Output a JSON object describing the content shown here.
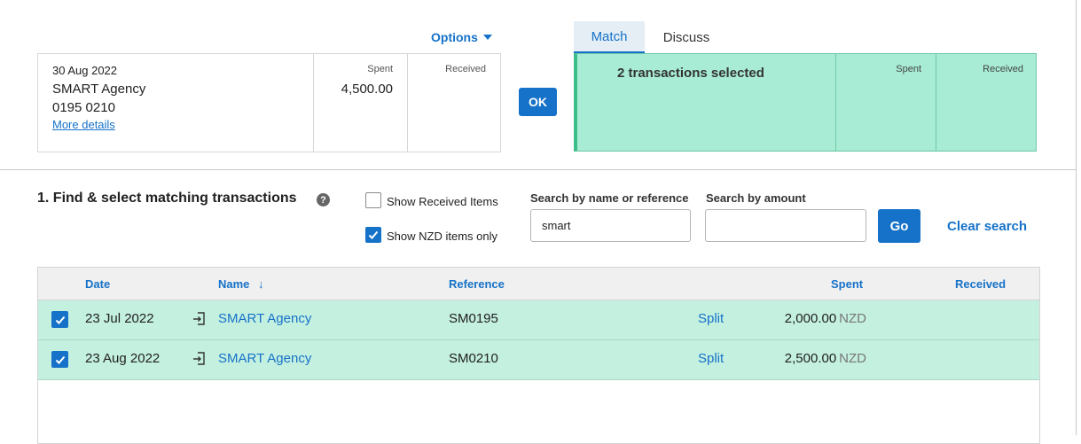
{
  "options_label": "Options",
  "statement": {
    "date": "30 Aug 2022",
    "name": "SMART Agency",
    "reference": "0195 0210",
    "more_details": "More details",
    "spent_header": "Spent",
    "spent_value": "4,500.00",
    "received_header": "Received"
  },
  "ok_label": "OK",
  "tabs": [
    {
      "label": "Match",
      "active": true
    },
    {
      "label": "Discuss",
      "active": false
    }
  ],
  "match_panel": {
    "summary": "2 transactions selected",
    "spent_header": "Spent",
    "received_header": "Received"
  },
  "find": {
    "title": "1. Find & select matching transactions",
    "help_icon": "?",
    "show_received": {
      "label": "Show Received Items",
      "checked": false
    },
    "show_nzd": {
      "label": "Show NZD items only",
      "checked": true
    },
    "search_name_label": "Search by name or reference",
    "search_name_value": "smart",
    "search_amount_label": "Search by amount",
    "search_amount_value": "",
    "go_label": "Go",
    "clear_label": "Clear search"
  },
  "table": {
    "headers": {
      "date": "Date",
      "name": "Name",
      "sort_arrow": "↓",
      "reference": "Reference",
      "spent": "Spent",
      "received": "Received"
    },
    "rows": [
      {
        "checked": true,
        "date": "23 Jul 2022",
        "name": "SMART Agency",
        "reference": "SM0195",
        "split": "Split",
        "spent": "2,000.00",
        "currency": "NZD",
        "received": ""
      },
      {
        "checked": true,
        "date": "23 Aug 2022",
        "name": "SMART Agency",
        "reference": "SM0210",
        "split": "Split",
        "spent": "2,500.00",
        "currency": "NZD",
        "received": ""
      }
    ]
  },
  "colors": {
    "accent": "#1672c8",
    "match_green": "#a8ecd5",
    "row_green": "#c4f0e0"
  }
}
